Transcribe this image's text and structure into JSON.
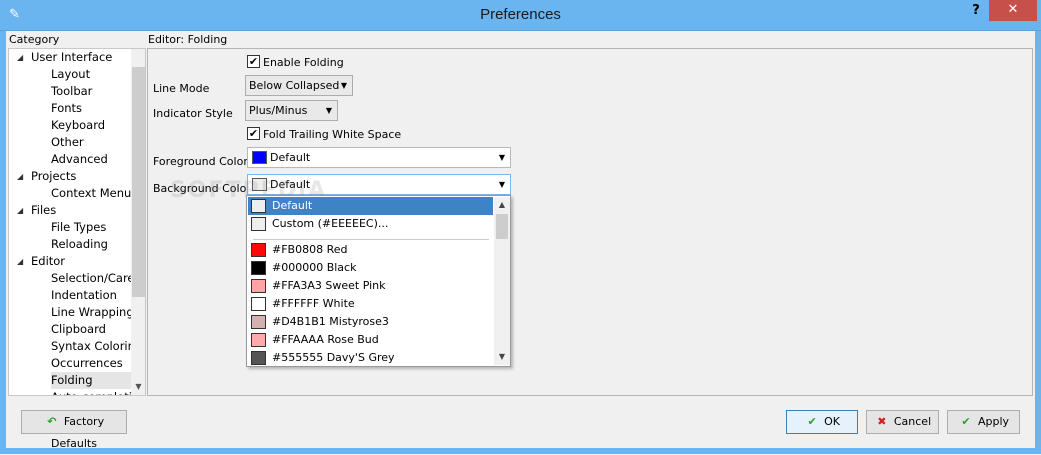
{
  "window": {
    "title": "Preferences",
    "help_glyph": "?",
    "close_glyph": "✕",
    "app_icon_glyph": "✎"
  },
  "category": {
    "label": "Category",
    "items": [
      {
        "label": "User Interface",
        "level": 0,
        "expanded": true
      },
      {
        "label": "Layout",
        "level": 1
      },
      {
        "label": "Toolbar",
        "level": 1
      },
      {
        "label": "Fonts",
        "level": 1
      },
      {
        "label": "Keyboard",
        "level": 1
      },
      {
        "label": "Other",
        "level": 1
      },
      {
        "label": "Advanced",
        "level": 1
      },
      {
        "label": "Projects",
        "level": 0,
        "expanded": true
      },
      {
        "label": "Context Menu",
        "level": 1
      },
      {
        "label": "Files",
        "level": 0,
        "expanded": true
      },
      {
        "label": "File Types",
        "level": 1
      },
      {
        "label": "Reloading",
        "level": 1
      },
      {
        "label": "Editor",
        "level": 0,
        "expanded": true
      },
      {
        "label": "Selection/Caret",
        "level": 1
      },
      {
        "label": "Indentation",
        "level": 1
      },
      {
        "label": "Line Wrapping",
        "level": 1
      },
      {
        "label": "Clipboard",
        "level": 1
      },
      {
        "label": "Syntax Coloring",
        "level": 1
      },
      {
        "label": "Occurrences",
        "level": 1
      },
      {
        "label": "Folding",
        "level": 1,
        "selected": true
      },
      {
        "label": "Auto-completion",
        "level": 1
      }
    ]
  },
  "editor": {
    "panel_label": "Editor: Folding",
    "enable_folding": {
      "label": "Enable Folding",
      "checked": true
    },
    "line_mode": {
      "label": "Line Mode",
      "value": "Below Collapsed"
    },
    "indicator_style": {
      "label": "Indicator Style",
      "value": "Plus/Minus"
    },
    "fold_trailing": {
      "label": "Fold Trailing White Space",
      "checked": true
    },
    "foreground": {
      "label": "Foreground Color",
      "value": "Default",
      "color": "#0000ff"
    },
    "background": {
      "label": "Background Color",
      "value": "Default",
      "color": "#eeeeec"
    }
  },
  "dropdown": {
    "items": [
      {
        "label": "Default",
        "color": "#eeeeec",
        "selected": true
      },
      {
        "label": "Custom (#EEEEEC)...",
        "color": "#eeeeec"
      },
      {
        "label": "#FB0808 Red",
        "color": "#fb0808"
      },
      {
        "label": "#000000 Black",
        "color": "#000000"
      },
      {
        "label": "#FFA3A3 Sweet Pink",
        "color": "#ffa3a3"
      },
      {
        "label": "#FFFFFF White",
        "color": "#ffffff"
      },
      {
        "label": "#D4B1B1 Mistyrose3",
        "color": "#d4b1b1"
      },
      {
        "label": "#FFAAAA Rose Bud",
        "color": "#ffaaaa"
      },
      {
        "label": "#555555 Davy'S Grey",
        "color": "#555555"
      }
    ]
  },
  "buttons": {
    "factory_defaults": "Factory Defaults",
    "ok": "OK",
    "cancel": "Cancel",
    "apply": "Apply"
  },
  "watermark": "SOFTPEDIA"
}
